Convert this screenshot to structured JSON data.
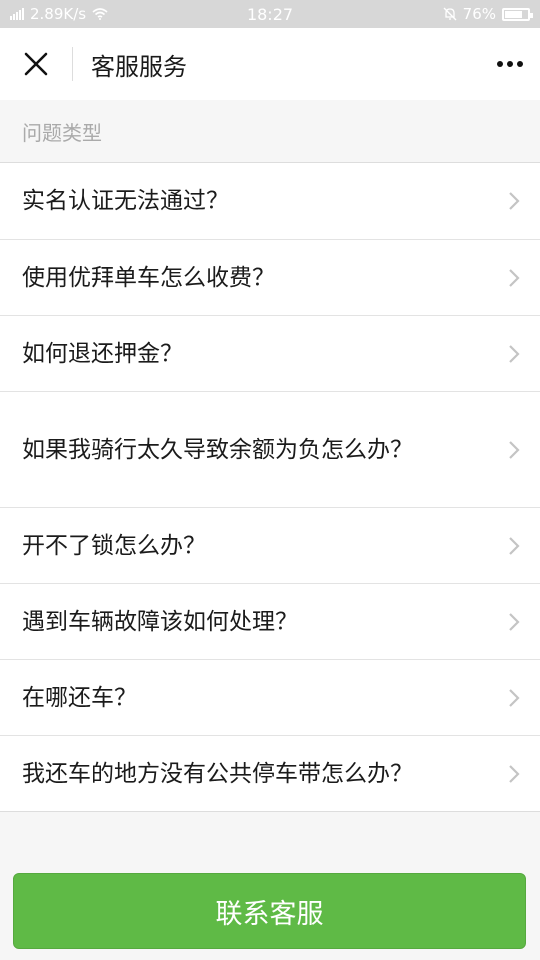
{
  "status_bar": {
    "network_speed": "2.89K/s",
    "time": "18:27",
    "battery": "76%",
    "battery_level": 0.76
  },
  "nav": {
    "title": "客服服务"
  },
  "section": {
    "header": "问题类型"
  },
  "questions": [
    "实名认证无法通过？",
    "使用优拜单车怎么收费？",
    "如何退还押金？",
    "如果我骑行太久导致余额为负怎么办？",
    "开不了锁怎么办？",
    "遇到车辆故障该如何处理？",
    "在哪还车？",
    "我还车的地方没有公共停车带怎么办？"
  ],
  "footer": {
    "contact_label": "联系客服"
  },
  "colors": {
    "primary_button": "#5fba46",
    "status_bar": "#d7d7d7"
  }
}
